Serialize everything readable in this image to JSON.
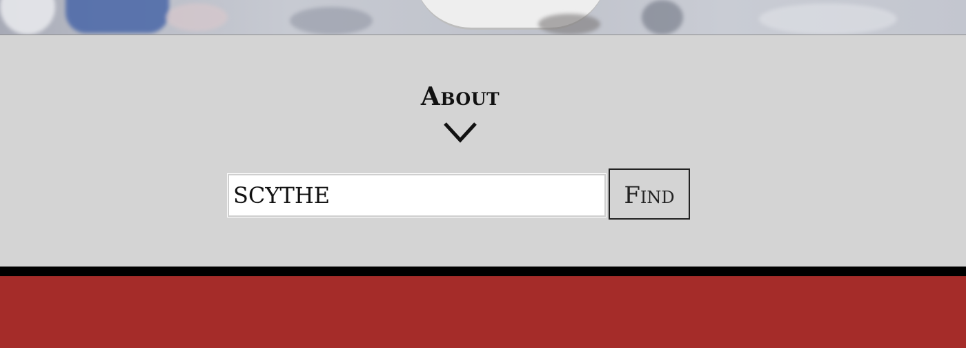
{
  "about": {
    "title": "About"
  },
  "search": {
    "value": "SCYTHE",
    "button_label": "Find"
  },
  "colors": {
    "band_background": "#d4d4d4",
    "footer_red": "#a52c29",
    "rule_black": "#000000"
  },
  "icons": {
    "scroll_indicator": "chevron-down-icon"
  }
}
